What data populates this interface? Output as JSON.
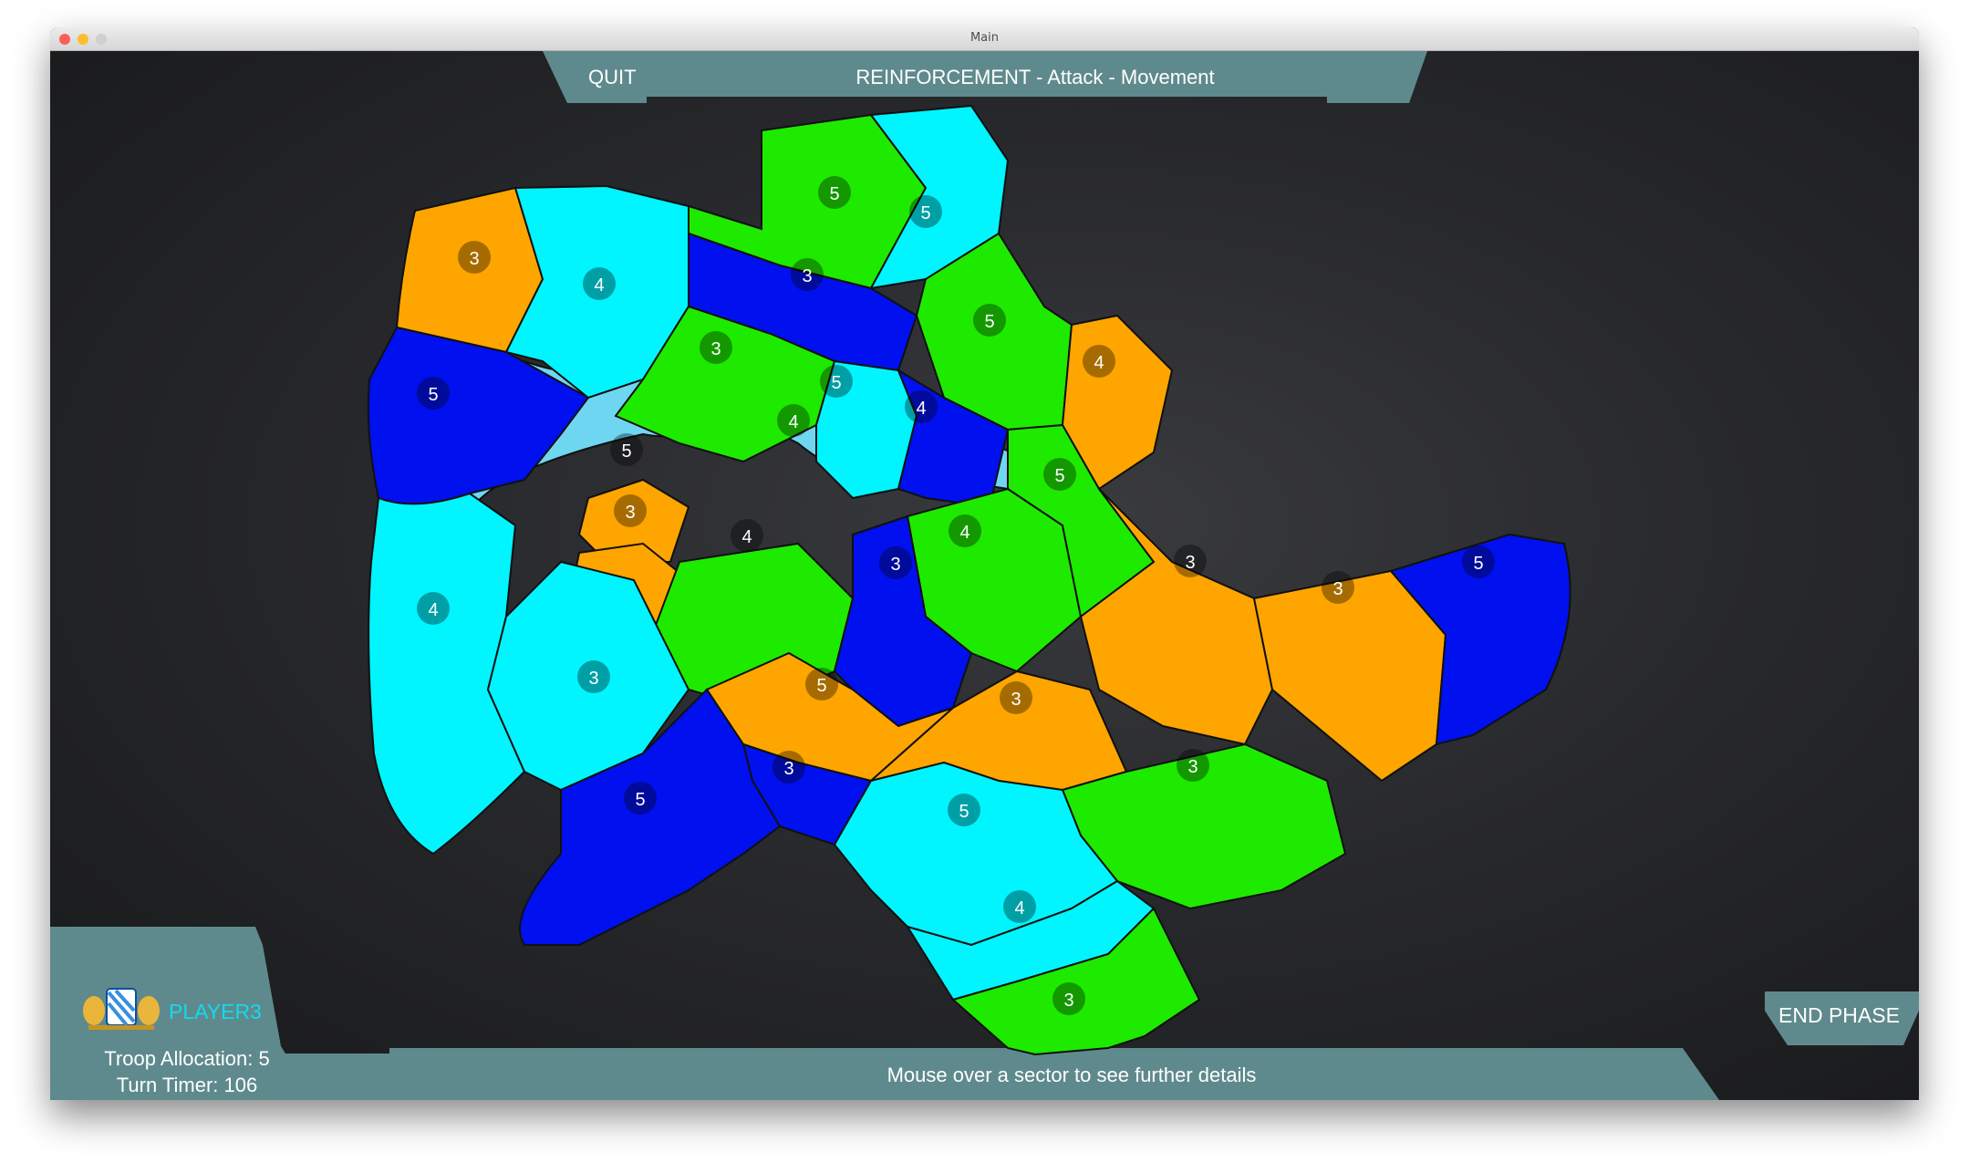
{
  "window": {
    "title": "Main"
  },
  "top_bar": {
    "quit_label": "QUIT",
    "phase_text": "REINFORCEMENT  -  Attack  -  Movement"
  },
  "player": {
    "name": "PLAYER3",
    "troop_allocation": "Troop Allocation: 5",
    "turn_timer": "Turn Timer: 106"
  },
  "end_phase_label": "END PHASE",
  "hint_text": "Mouse over a sector to see further details",
  "colors": {
    "cyan": "#00f5ff",
    "blue": "#0010ee",
    "green": "#1eea00",
    "orange": "#ffa500",
    "water": "#6fd6f2",
    "hud": "#5f8a8d",
    "player_text": "#12d9f0"
  },
  "sectors": [
    {
      "troops": "5",
      "owner": "green"
    },
    {
      "troops": "5",
      "owner": "cyan"
    },
    {
      "troops": "3",
      "owner": "orange"
    },
    {
      "troops": "4",
      "owner": "cyan"
    },
    {
      "troops": "3",
      "owner": "blue"
    },
    {
      "troops": "5",
      "owner": "green"
    },
    {
      "troops": "4",
      "owner": "orange"
    },
    {
      "troops": "5",
      "owner": "blue"
    },
    {
      "troops": "3",
      "owner": "green"
    },
    {
      "troops": "5",
      "owner": "cyan"
    },
    {
      "troops": "4",
      "owner": "cyan"
    },
    {
      "troops": "4",
      "owner": "blue"
    },
    {
      "troops": "5",
      "owner": "orange"
    },
    {
      "troops": "3",
      "owner": "orange"
    },
    {
      "troops": "5",
      "owner": "green"
    },
    {
      "troops": "4",
      "owner": "cyan"
    },
    {
      "troops": "4",
      "owner": "green"
    },
    {
      "troops": "4",
      "owner": "green"
    },
    {
      "troops": "3",
      "owner": "blue"
    },
    {
      "troops": "3",
      "owner": "orange"
    },
    {
      "troops": "3",
      "owner": "orange"
    },
    {
      "troops": "5",
      "owner": "blue"
    },
    {
      "troops": "3",
      "owner": "cyan"
    },
    {
      "troops": "5",
      "owner": "orange"
    },
    {
      "troops": "3",
      "owner": "orange"
    },
    {
      "troops": "3",
      "owner": "blue"
    },
    {
      "troops": "5",
      "owner": "blue"
    },
    {
      "troops": "3",
      "owner": "green"
    },
    {
      "troops": "5",
      "owner": "cyan"
    },
    {
      "troops": "4",
      "owner": "cyan"
    },
    {
      "troops": "3",
      "owner": "green"
    }
  ]
}
